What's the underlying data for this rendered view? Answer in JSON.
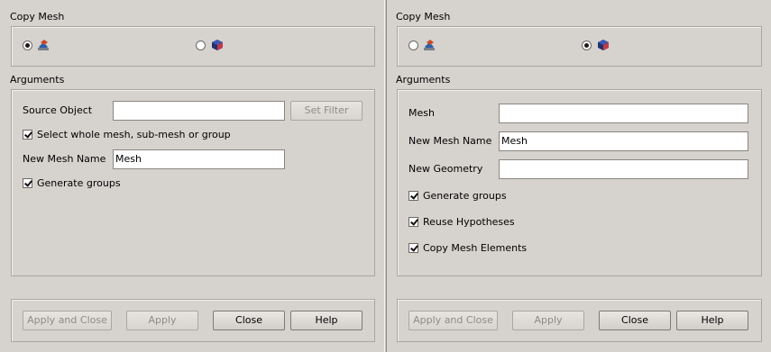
{
  "left": {
    "group_title": "Copy Mesh",
    "mode_radio_1_checked": true,
    "mode_radio_2_checked": false,
    "arguments_title": "Arguments",
    "source_object_label": "Source Object",
    "source_object_value": "",
    "set_filter_label": "Set Filter",
    "select_whole_label": "Select whole mesh, sub-mesh or group",
    "new_mesh_name_label": "New Mesh Name",
    "new_mesh_name_value": "Mesh",
    "generate_groups_label": "Generate groups",
    "buttons": {
      "apply_close": "Apply and Close",
      "apply": "Apply",
      "close": "Close",
      "help": "Help"
    }
  },
  "right": {
    "group_title": "Copy Mesh",
    "mode_radio_1_checked": false,
    "mode_radio_2_checked": true,
    "arguments_title": "Arguments",
    "mesh_label": "Mesh",
    "mesh_value": "",
    "new_mesh_name_label": "New Mesh Name",
    "new_mesh_name_value": "Mesh",
    "new_geometry_label": "New Geometry",
    "new_geometry_value": "",
    "generate_groups_label": "Generate groups",
    "reuse_hypotheses_label": "Reuse Hypotheses",
    "copy_elements_label": "Copy Mesh Elements",
    "buttons": {
      "apply_close": "Apply and Close",
      "apply": "Apply",
      "close": "Close",
      "help": "Help"
    }
  },
  "icons": {
    "copy_mesh_icon": "copy-mesh-icon",
    "copy_mesh_with_geom_icon": "copy-mesh-with-geometry-icon"
  }
}
